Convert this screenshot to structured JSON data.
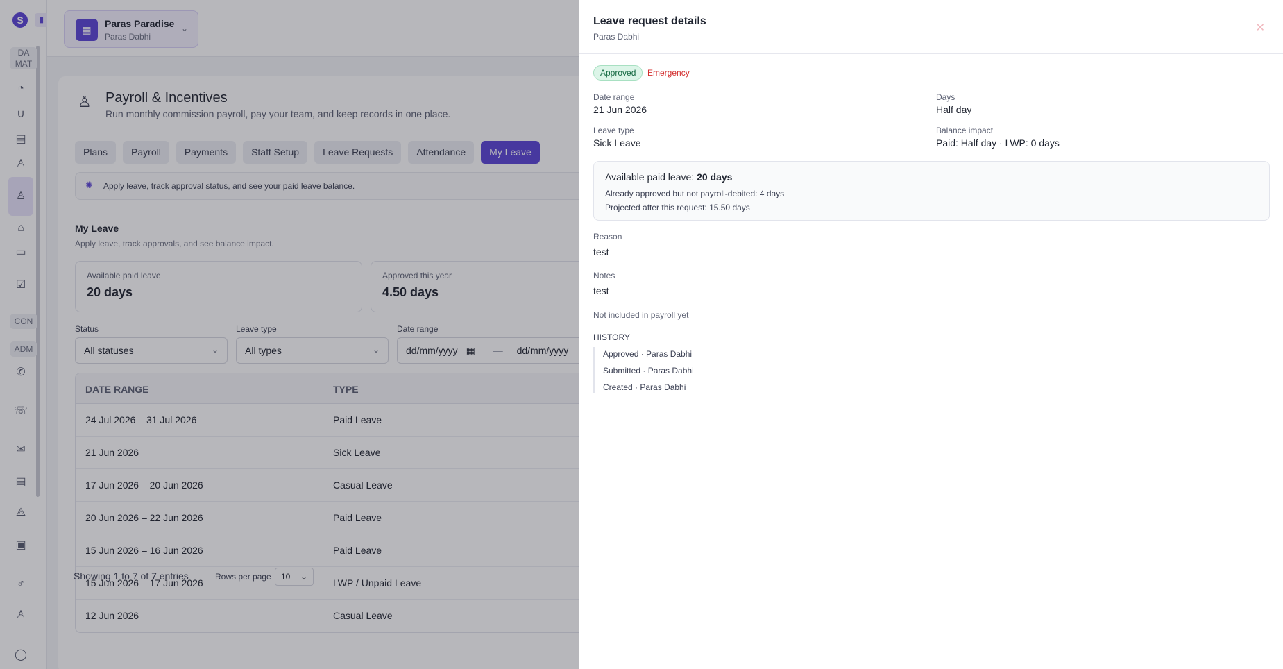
{
  "sidebar": {
    "labels": [
      "DA\nMAT",
      "CON",
      "ADM"
    ],
    "label_1": "DA",
    "label_1b": "MAT",
    "label_2": "CON",
    "label_3": "ADM"
  },
  "topbar": {
    "org_name": "Paras Paradise",
    "org_user": "Paras Dabhi"
  },
  "page": {
    "title": "Payroll & Incentives",
    "subtitle": "Run monthly commission payroll, pay your team, and keep records in one place.",
    "tabs": [
      "Plans",
      "Payroll",
      "Payments",
      "Staff Setup",
      "Leave Requests",
      "Attendance",
      "My Leave"
    ],
    "active_tab": "My Leave",
    "hint": "Apply leave, track approval status, and see your paid leave balance."
  },
  "my_leave": {
    "title": "My Leave",
    "subtitle": "Apply leave, track approvals, and see balance impact.",
    "stats": [
      {
        "label": "Available paid leave",
        "value": "20 days"
      },
      {
        "label": "Approved this year",
        "value": "4.50 days"
      }
    ],
    "filters": {
      "status_label": "Status",
      "status_value": "All statuses",
      "type_label": "Leave type",
      "type_value": "All types",
      "date_label": "Date range",
      "date_from": "dd/mm/yyyy",
      "date_sep": "—",
      "date_to": "dd/mm/yyyy"
    },
    "columns": [
      "DATE RANGE",
      "TYPE"
    ],
    "rows": [
      {
        "date": "24 Jul 2026 – 31 Jul 2026",
        "type": "Paid Leave"
      },
      {
        "date": "21 Jun 2026",
        "type": "Sick Leave"
      },
      {
        "date": "17 Jun 2026 – 20 Jun 2026",
        "type": "Casual Leave"
      },
      {
        "date": "20 Jun 2026 – 22 Jun 2026",
        "type": "Paid Leave"
      },
      {
        "date": "15 Jun 2026 – 16 Jun 2026",
        "type": "Paid Leave"
      },
      {
        "date": "15 Jun 2026 – 17 Jun 2026",
        "type": "LWP / Unpaid Leave"
      },
      {
        "date": "12 Jun 2026",
        "type": "Casual Leave"
      }
    ],
    "footer": {
      "showing": "Showing 1 to 7 of 7 entries",
      "rows_per_page_label": "Rows per page",
      "rows_per_page": "10"
    }
  },
  "drawer": {
    "title": "Leave request details",
    "subtitle": "Paras Dabhi",
    "status_badge": "Approved",
    "category_badge": "Emergency",
    "date_range_label": "Date range",
    "date_range": "21 Jun 2026",
    "days_label": "Days",
    "days": "Half day",
    "leave_type_label": "Leave type",
    "leave_type": "Sick Leave",
    "balance_impact_label": "Balance impact",
    "balance_impact": "Paid: Half day · LWP: 0 days",
    "balance": {
      "prefix": "Available paid leave: ",
      "value": "20 days",
      "line1": "Already approved but not payroll-debited: 4 days",
      "line2": "Projected after this request: 15.50 days"
    },
    "reason_label": "Reason",
    "reason": "test",
    "notes_label": "Notes",
    "notes": "test",
    "payroll_status": "Not included in payroll yet",
    "history_label": "HISTORY",
    "history": [
      "Approved · Paras Dabhi",
      "Submitted · Paras Dabhi",
      "Created · Paras Dabhi"
    ]
  },
  "colors": {
    "accent": "#5b44d6",
    "approved_bg": "#dcf5e8",
    "emergency": "#d32f2f"
  }
}
